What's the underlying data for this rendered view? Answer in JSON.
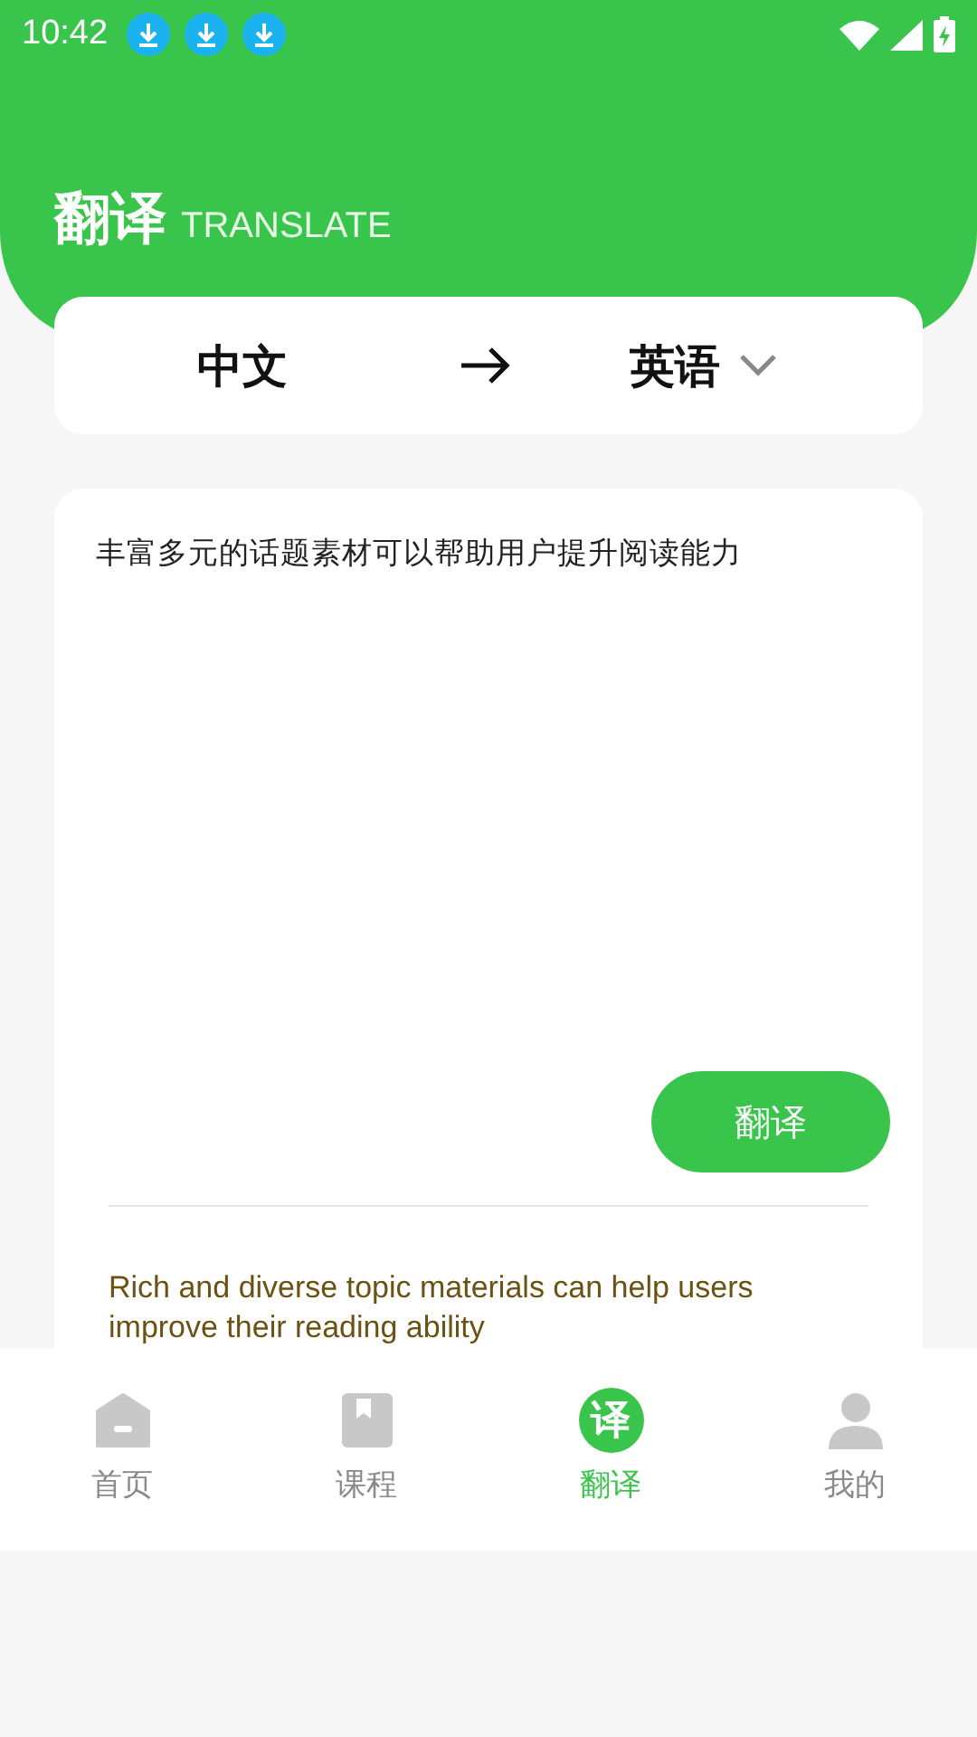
{
  "status_bar": {
    "time": "10:42",
    "notifications": [
      {
        "kind": "download"
      },
      {
        "kind": "download"
      },
      {
        "kind": "download"
      }
    ]
  },
  "header": {
    "title": "翻译",
    "subtitle": "TRANSLATE"
  },
  "languages": {
    "source": "中文",
    "target": "英语"
  },
  "input": {
    "value": "丰富多元的话题素材可以帮助用户提升阅读能力"
  },
  "translate_button": "翻译",
  "result": "Rich and diverse topic materials can help users improve their reading ability",
  "tabs": [
    {
      "label": "首页",
      "kind": "home",
      "selected": false
    },
    {
      "label": "课程",
      "kind": "book",
      "selected": false
    },
    {
      "label": "翻译",
      "kind": "glyph",
      "icon_text": "译",
      "selected": true
    },
    {
      "label": "我的",
      "kind": "person",
      "selected": false
    }
  ]
}
